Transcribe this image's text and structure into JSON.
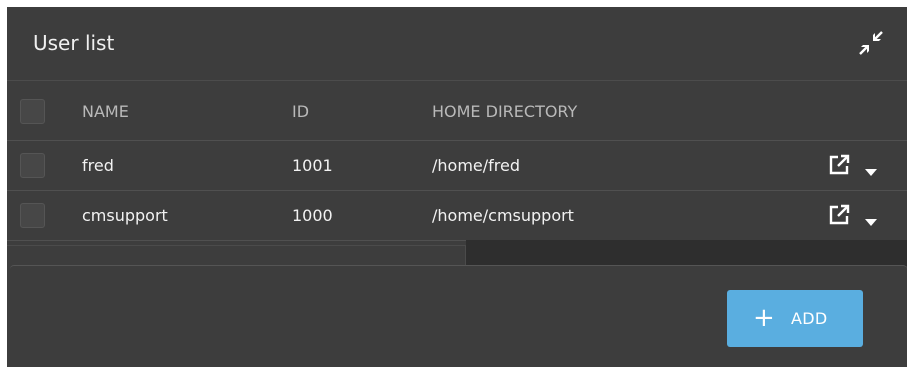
{
  "panel": {
    "title": "User list",
    "collapse_icon": "collapse-arrows-icon"
  },
  "table": {
    "columns": [
      "NAME",
      "ID",
      "HOME DIRECTORY"
    ],
    "rows": [
      {
        "name": "fred",
        "id": "1001",
        "home": "/home/fred"
      },
      {
        "name": "cmsupport",
        "id": "1000",
        "home": "/home/cmsupport"
      }
    ],
    "row_action_icons": [
      "open-external-icon",
      "caret-down-icon"
    ]
  },
  "footer": {
    "add_label": "ADD",
    "add_icon": "plus-icon"
  },
  "colors": {
    "panel_bg": "#3d3d3d",
    "accent": "#5aaee0",
    "text": "#f2f2f2",
    "header_text": "#b9b9b9"
  }
}
